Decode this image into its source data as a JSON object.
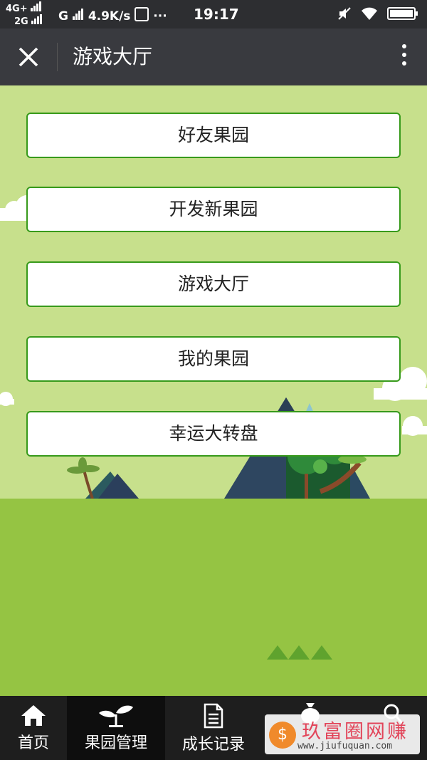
{
  "status_bar": {
    "network_top": "4G+",
    "network_bottom": "2G",
    "network_g": "G",
    "speed": "4.9K/s",
    "dots": "···",
    "time": "19:17",
    "icons": [
      "signal-icon",
      "mute-icon",
      "wifi-icon",
      "battery-icon"
    ]
  },
  "title_bar": {
    "title": "游戏大厅",
    "close_icon": "close-icon",
    "more_icon": "more-vertical-icon"
  },
  "menu": {
    "items": [
      {
        "label": "好友果园"
      },
      {
        "label": "开发新果园"
      },
      {
        "label": "游戏大厅"
      },
      {
        "label": "我的果园"
      },
      {
        "label": "幸运大转盘"
      }
    ]
  },
  "tab_bar": {
    "tabs": [
      {
        "label": "首页",
        "icon": "home-icon"
      },
      {
        "label": "果园管理",
        "icon": "sprout-icon",
        "active": true
      },
      {
        "label": "成长记录",
        "icon": "document-icon"
      },
      {
        "label": "",
        "icon": "money-bag-icon"
      },
      {
        "label": "",
        "icon": "search-icon"
      }
    ]
  },
  "watermark": {
    "logo_char": "$",
    "title": "玖富圈网赚",
    "url": "www.jiufuquan.com"
  },
  "colors": {
    "title_bar_bg": "#393a3f",
    "status_bar_bg": "#2d2e31",
    "scene_bg": "#c7e08c",
    "ground": "#95c443",
    "button_border": "#379a1b",
    "tab_bar_bg": "#1e1e1e"
  }
}
